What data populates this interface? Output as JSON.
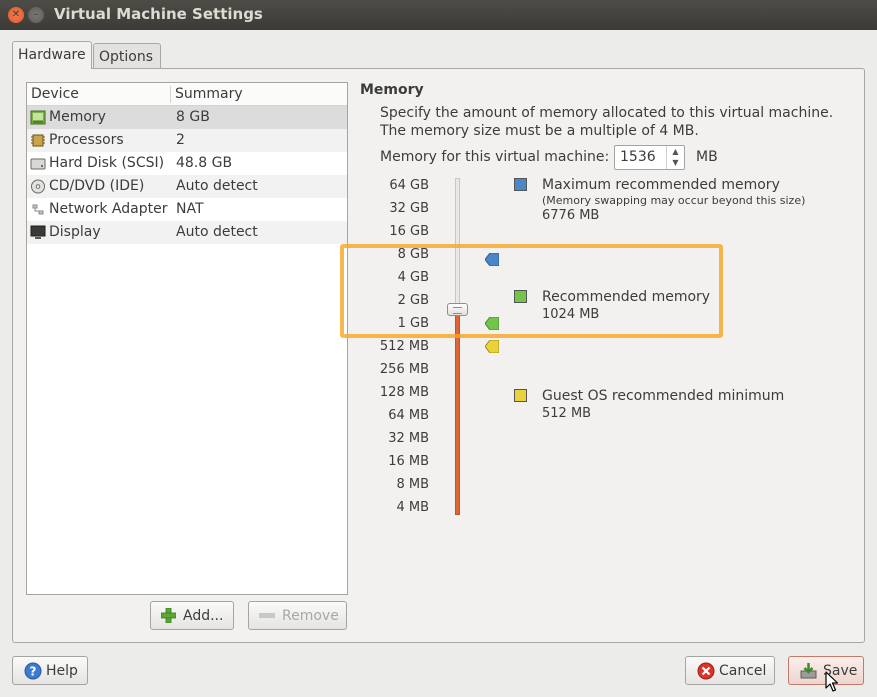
{
  "window": {
    "title": "Virtual Machine Settings"
  },
  "tabs": [
    {
      "label": "Hardware",
      "active": true
    },
    {
      "label": "Options",
      "active": false
    }
  ],
  "device_list": {
    "headers": {
      "device": "Device",
      "summary": "Summary"
    },
    "rows": [
      {
        "name": "Memory",
        "summary": "8 GB",
        "icon": "memory-icon"
      },
      {
        "name": "Processors",
        "summary": "2",
        "icon": "processor-icon"
      },
      {
        "name": "Hard Disk (SCSI)",
        "summary": "48.8 GB",
        "icon": "hard-disk-icon"
      },
      {
        "name": "CD/DVD (IDE)",
        "summary": "Auto detect",
        "icon": "cd-dvd-icon"
      },
      {
        "name": "Network Adapter",
        "summary": "NAT",
        "icon": "network-icon"
      },
      {
        "name": "Display",
        "summary": "Auto detect",
        "icon": "display-icon"
      }
    ],
    "selected_index": 0
  },
  "buttons": {
    "add": "Add...",
    "remove": "Remove",
    "help": "Help",
    "cancel": "Cancel",
    "save": "Save"
  },
  "memory": {
    "title": "Memory",
    "description": "Specify the amount of memory allocated to this virtual machine. The memory size must be a multiple of 4 MB.",
    "field_label": "Memory for this virtual machine:",
    "value": "1536",
    "unit": "MB",
    "scale_labels": [
      "64 GB",
      "32 GB",
      "16 GB",
      "8 GB",
      "4 GB",
      "2 GB",
      "1 GB",
      "512 MB",
      "256 MB",
      "128 MB",
      "64 MB",
      "32 MB",
      "16 MB",
      "8 MB",
      "4 MB"
    ],
    "legend": {
      "max": {
        "title": "Maximum recommended memory",
        "note": "(Memory swapping may occur beyond this size)",
        "value": "6776 MB",
        "color": "#4a86c8"
      },
      "recommended": {
        "title": "Recommended memory",
        "value": "1024 MB",
        "color": "#73c44a"
      },
      "minimum": {
        "title": "Guest OS recommended minimum",
        "value": "512 MB",
        "color": "#e9d33a"
      }
    }
  },
  "colors": {
    "slider_fill": "#e06534",
    "highlight": "#f5a623"
  }
}
